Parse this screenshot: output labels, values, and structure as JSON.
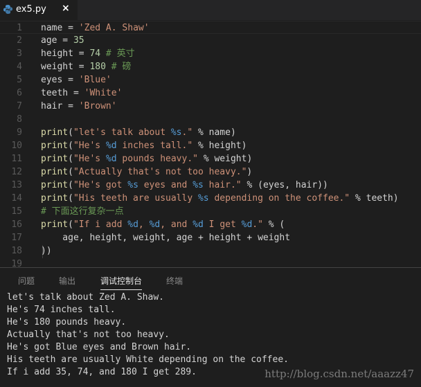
{
  "tab": {
    "filename": "ex5.py",
    "close_icon": "×",
    "icon": "python-icon"
  },
  "code_lines": [
    [
      [
        "v",
        "name"
      ],
      [
        "p",
        " = "
      ],
      [
        "s",
        "'Zed A. Shaw'"
      ]
    ],
    [
      [
        "v",
        "age"
      ],
      [
        "p",
        " = "
      ],
      [
        "n",
        "35"
      ]
    ],
    [
      [
        "v",
        "height"
      ],
      [
        "p",
        " = "
      ],
      [
        "n",
        "74"
      ],
      [
        "c",
        " # 英寸"
      ]
    ],
    [
      [
        "v",
        "weight"
      ],
      [
        "p",
        " = "
      ],
      [
        "n",
        "180"
      ],
      [
        "c",
        " # 磅"
      ]
    ],
    [
      [
        "v",
        "eyes"
      ],
      [
        "p",
        " = "
      ],
      [
        "s",
        "'Blue'"
      ]
    ],
    [
      [
        "v",
        "teeth"
      ],
      [
        "p",
        " = "
      ],
      [
        "s",
        "'White'"
      ]
    ],
    [
      [
        "v",
        "hair"
      ],
      [
        "p",
        " = "
      ],
      [
        "s",
        "'Brown'"
      ]
    ],
    [],
    [
      [
        "f",
        "print"
      ],
      [
        "p",
        "("
      ],
      [
        "s",
        "\"let's talk about "
      ],
      [
        "k",
        "%s"
      ],
      [
        "s",
        ".\""
      ],
      [
        "p",
        " % name)"
      ]
    ],
    [
      [
        "f",
        "print"
      ],
      [
        "p",
        "("
      ],
      [
        "s",
        "\"He's "
      ],
      [
        "k",
        "%d"
      ],
      [
        "s",
        " inches tall.\""
      ],
      [
        "p",
        " % height)"
      ]
    ],
    [
      [
        "f",
        "print"
      ],
      [
        "p",
        "("
      ],
      [
        "s",
        "\"He's "
      ],
      [
        "k",
        "%d"
      ],
      [
        "s",
        " pounds heavy.\""
      ],
      [
        "p",
        " % weight)"
      ]
    ],
    [
      [
        "f",
        "print"
      ],
      [
        "p",
        "("
      ],
      [
        "s",
        "\"Actually that's not too heavy.\""
      ],
      [
        "p",
        ")"
      ]
    ],
    [
      [
        "f",
        "print"
      ],
      [
        "p",
        "("
      ],
      [
        "s",
        "\"He's got "
      ],
      [
        "k",
        "%s"
      ],
      [
        "s",
        " eyes and "
      ],
      [
        "k",
        "%s"
      ],
      [
        "s",
        " hair.\""
      ],
      [
        "p",
        " % (eyes, hair))"
      ]
    ],
    [
      [
        "f",
        "print"
      ],
      [
        "p",
        "("
      ],
      [
        "s",
        "\"His teeth are usually "
      ],
      [
        "k",
        "%s"
      ],
      [
        "s",
        " depending on the coffee.\""
      ],
      [
        "p",
        " % teeth)"
      ]
    ],
    [
      [
        "c",
        "# 下面这行复杂一点"
      ]
    ],
    [
      [
        "f",
        "print"
      ],
      [
        "p",
        "("
      ],
      [
        "s",
        "\"If i add "
      ],
      [
        "k",
        "%d"
      ],
      [
        "s",
        ", "
      ],
      [
        "k",
        "%d"
      ],
      [
        "s",
        ", and "
      ],
      [
        "k",
        "%d"
      ],
      [
        "s",
        " I get "
      ],
      [
        "k",
        "%d"
      ],
      [
        "s",
        ".\""
      ],
      [
        "p",
        " % ("
      ]
    ],
    [
      [
        "p",
        "    age, height, weight, age + height + weight"
      ]
    ],
    [
      [
        "p",
        "))"
      ]
    ],
    []
  ],
  "panel": {
    "tabs": [
      "问题",
      "输出",
      "调试控制台",
      "终端"
    ],
    "active": 2,
    "output": [
      "let's talk about Zed A. Shaw.",
      "He's 74 inches tall.",
      "He's 180 pounds heavy.",
      "Actually that's not too heavy.",
      "He's got Blue eyes and Brown hair.",
      "His teeth are usually White depending on the coffee.",
      "If i add 35, 74, and 180 I get 289."
    ]
  },
  "watermark": "http://blog.csdn.net/aaazz47"
}
